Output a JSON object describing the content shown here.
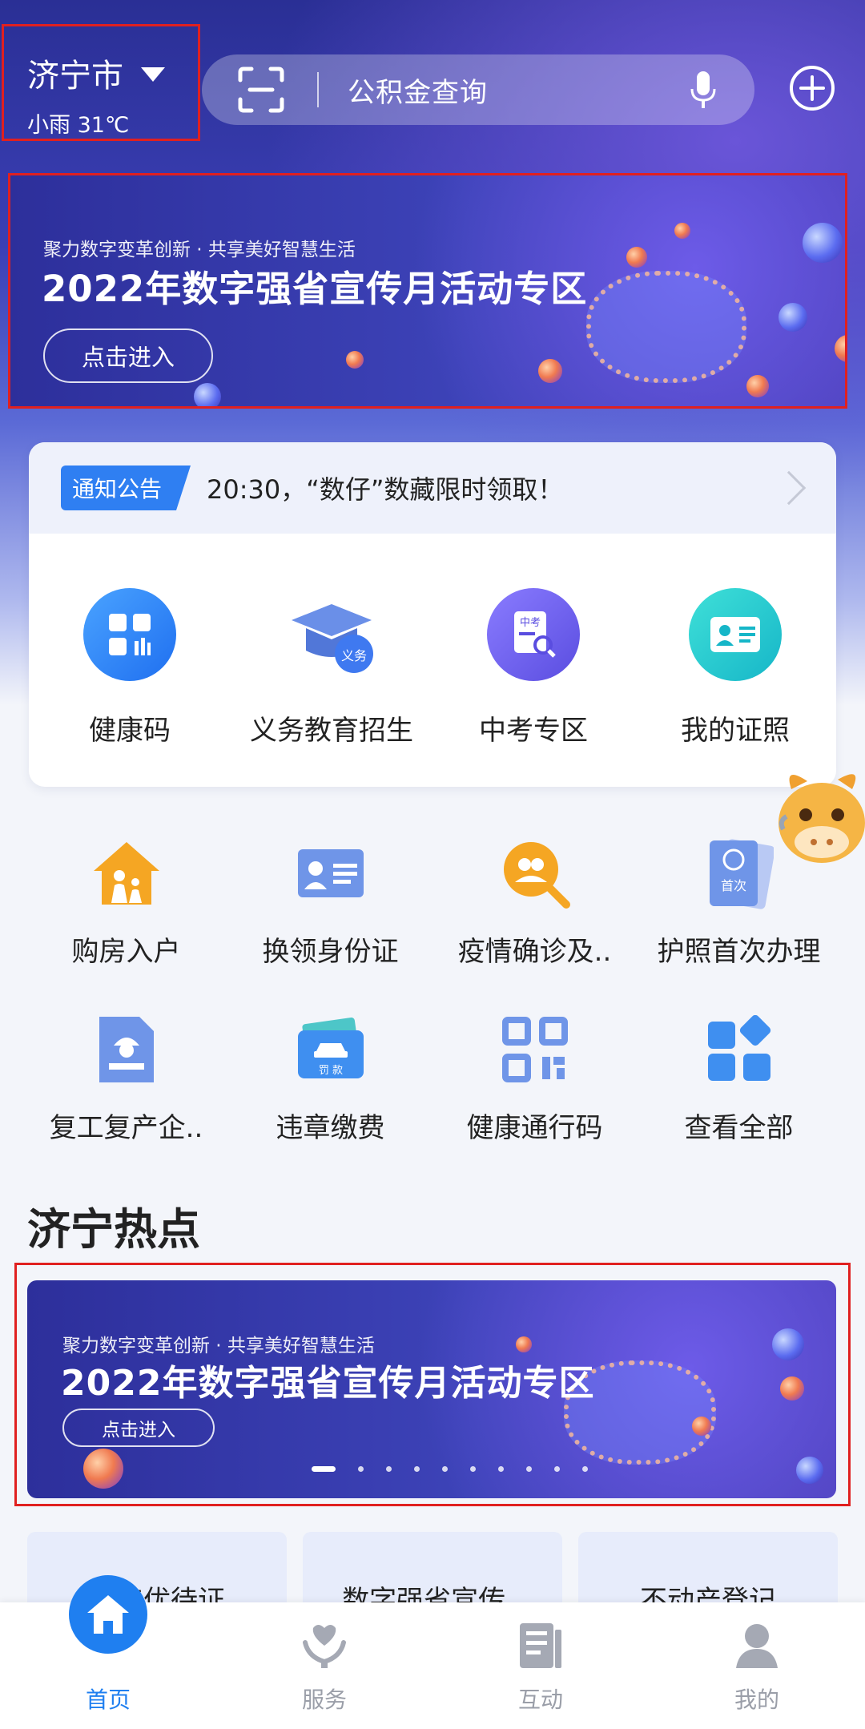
{
  "header": {
    "city": "济宁市",
    "weather": "小雨 31℃",
    "search_placeholder": "公积金查询"
  },
  "banner_top": {
    "subtitle": "聚力数字变革创新 · 共享美好智慧生活",
    "title": "2022年数字强省宣传月活动专区",
    "button": "点击进入"
  },
  "notice": {
    "tag": "通知公告",
    "text": "20:30，“数仔”数藏限时领取！"
  },
  "quick_services": [
    {
      "label": "健康码",
      "icon": "health-code-icon"
    },
    {
      "label": "义务教育招生",
      "icon": "graduation-cap-icon"
    },
    {
      "label": "中考专区",
      "icon": "exam-search-icon"
    },
    {
      "label": "我的证照",
      "icon": "id-card-icon"
    }
  ],
  "services": [
    {
      "label": "购房入户",
      "icon": "house-family-icon"
    },
    {
      "label": "换领身份证",
      "icon": "id-card-icon"
    },
    {
      "label": "疫情确诊及..",
      "icon": "epidemic-search-icon"
    },
    {
      "label": "护照首次办理",
      "icon": "passport-icon"
    },
    {
      "label": "复工复产企..",
      "icon": "worker-document-icon"
    },
    {
      "label": "违章缴费",
      "icon": "car-fine-icon"
    },
    {
      "label": "健康通行码",
      "icon": "qr-code-icon"
    },
    {
      "label": "查看全部",
      "icon": "all-apps-icon"
    }
  ],
  "icon_texts": {
    "exam": "中考",
    "yiwu": "义务",
    "passport": "首次",
    "fine": "罚 款"
  },
  "hot_section": {
    "title": "济宁热点"
  },
  "banner_bottom": {
    "subtitle": "聚力数字变革创新 · 共享美好智慧生活",
    "title": "2022年数字强省宣传月活动专区",
    "button": "点击进入",
    "slide_count": 10,
    "active_slide": 1
  },
  "hot_tags": [
    "老年优待证",
    "数字强省宣传..",
    "不动产登记"
  ],
  "tabbar": [
    {
      "label": "首页",
      "active": true
    },
    {
      "label": "服务",
      "active": false
    },
    {
      "label": "互动",
      "active": false
    },
    {
      "label": "我的",
      "active": false
    }
  ],
  "colors": {
    "primary": "#1f7ff0",
    "highlight_box": "#e02020"
  }
}
